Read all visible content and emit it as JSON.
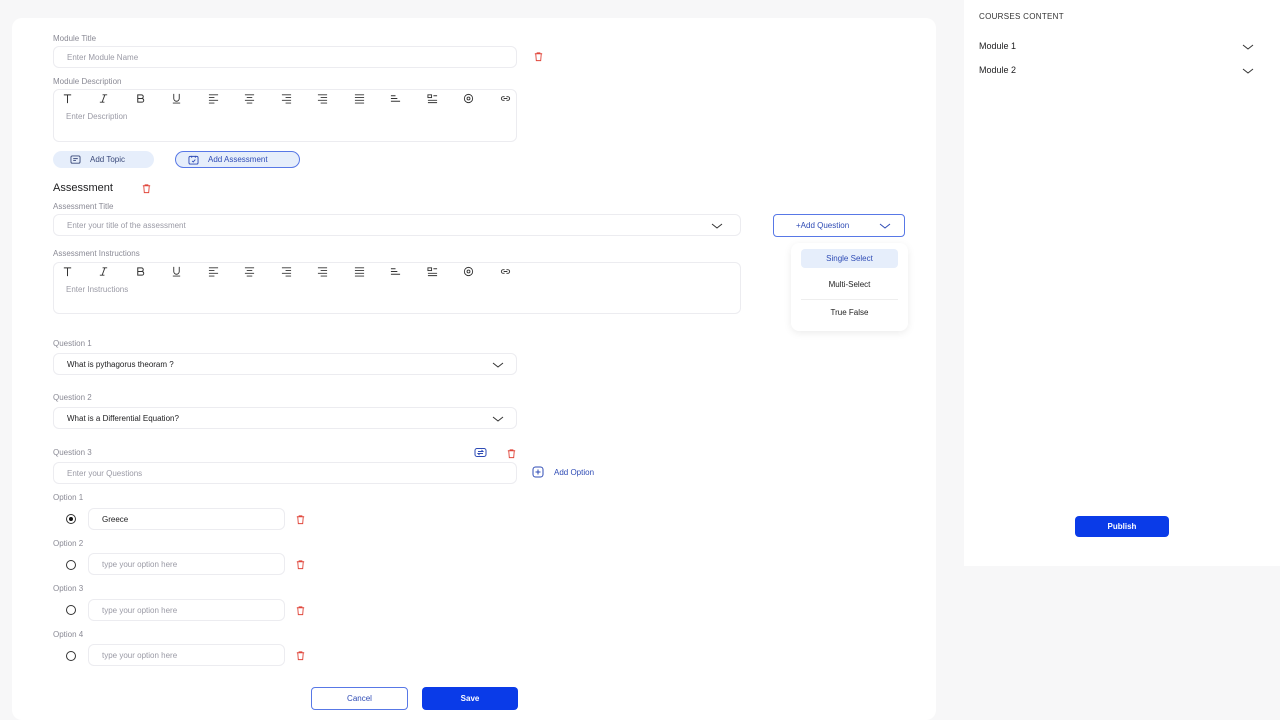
{
  "module": {
    "title_label": "Module Title",
    "title_placeholder": "Enter Module Name",
    "desc_label": "Module Description",
    "desc_placeholder": "Enter Description",
    "add_topic": "Add Topic",
    "add_assessment": "Add Assessment"
  },
  "toolbar_icons": [
    "text-type-icon",
    "italic-icon",
    "bold-icon",
    "underline-icon",
    "align-left-icon",
    "align-center-icon",
    "align-right-icon",
    "align-justify-icon",
    "list-icon",
    "indent-icon",
    "image-list-icon",
    "mention-icon",
    "link-icon"
  ],
  "assessment": {
    "heading": "Assessment",
    "title_label": "Assessment Title",
    "title_placeholder": "Enter your title of the assessment",
    "add_question": "+Add Question",
    "instructions_label": "Assessment Instructions",
    "instructions_placeholder": "Enter Instructions"
  },
  "dropdown": {
    "options": [
      "Single Select",
      "Multi-Select",
      "True False"
    ]
  },
  "questions": {
    "q1_label": "Question 1",
    "q1_value": "What is pythagorus theoram ?",
    "q2_label": "Question 2",
    "q2_value": "What is a Differential Equation?",
    "q3_label": "Question 3",
    "q3_placeholder": "Enter your Questions",
    "add_option": "Add Option"
  },
  "options": [
    {
      "label": "Option  1",
      "value": "Greece",
      "placeholder": ""
    },
    {
      "label": "Option 2",
      "value": "",
      "placeholder": "type your option here"
    },
    {
      "label": "Option 3",
      "value": "",
      "placeholder": "type your option here"
    },
    {
      "label": "Option 4",
      "value": "",
      "placeholder": "type your option here"
    }
  ],
  "actions": {
    "cancel": "Cancel",
    "save": "Save"
  },
  "sidebar": {
    "heading": "COURSES CONTENT",
    "modules": [
      "Module 1",
      "Module 2"
    ],
    "publish": "Publish"
  },
  "colors": {
    "accent": "#0a3be8",
    "trash": "#e0453a",
    "pill_bg": "#e6eefb"
  }
}
